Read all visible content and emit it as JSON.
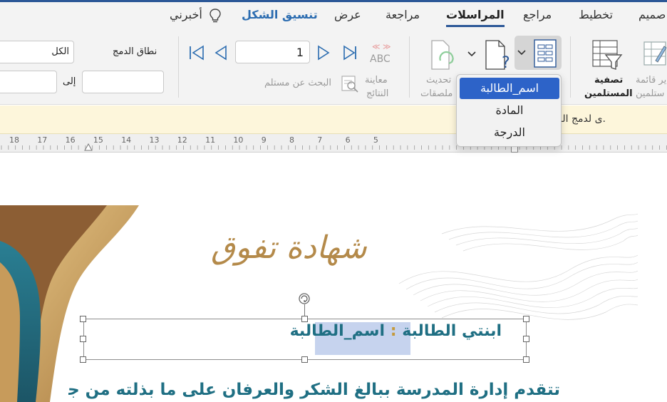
{
  "tabs": {
    "design": "صميم",
    "layout": "تخطيط",
    "references": "مراجع",
    "mailings": "المراسلات",
    "review": "مراجعة",
    "view": "عرض",
    "shape_format": "تنسيق الشكل",
    "tell_me": "أخبرني"
  },
  "ribbon": {
    "edit_recipients": "ير قائمة",
    "edit_recipients_2": "ستلمين",
    "filter_recipients": "تصفية",
    "filter_recipients_2": "المستلمين",
    "update_labels": "تحديث",
    "update_labels_2": "ملصقات",
    "preview_results": "معاينة",
    "preview_results_2": "النتائج",
    "find_recipient": "البحث عن مستلم",
    "record_number": "1",
    "merge_range_label": "نطاق الدمج",
    "merge_range_value": "الكل",
    "to_label": "إلى",
    "abc": "ABC"
  },
  "merge_field_menu": {
    "items": [
      "اسم_الطالبة",
      "المادة",
      "الدرجة"
    ],
    "selected_index": 0
  },
  "message_bar": {
    "text": "ى لدمج البريد."
  },
  "ruler": {
    "numbers": [
      "18",
      "17",
      "16",
      "15",
      "14",
      "13",
      "12",
      "11",
      "10",
      "9",
      "8",
      "7",
      "6",
      "5"
    ]
  },
  "document": {
    "title": "شهادة تفوق",
    "line1_prefix": "ابنتي الطالبة",
    "line1_colon": ":",
    "line1_field": "اسم_الطالبة",
    "line2": "تتقدم إدارة المدرسة ببالغ الشكر والعرفان على ما بذلته من جد"
  },
  "colors": {
    "accent_blue": "#2b5797",
    "teal_text": "#1f6f83",
    "gold": "#b48a4a",
    "selection": "#2d63c8",
    "message_bar_bg": "#fdf6db"
  }
}
